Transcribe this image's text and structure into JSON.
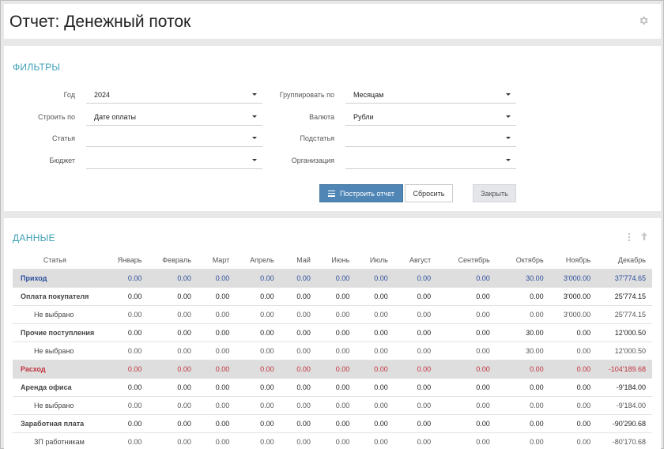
{
  "page": {
    "title": "Отчет: Денежный поток"
  },
  "colors": {
    "accent": "#3d9fb6",
    "primary_button": "#4f86b6",
    "income": "#2c4f9e",
    "expense": "#c0313d"
  },
  "icons": {
    "settings": "gear-icon",
    "build": "list-icon",
    "menu": "vertical-dots-icon",
    "collapse": "arrow-up-icon"
  },
  "filters": {
    "title": "ФИЛЬТРЫ",
    "year": {
      "label": "Год",
      "value": "2024"
    },
    "build_by": {
      "label": "Строить по",
      "value": "Дате оплаты"
    },
    "article": {
      "label": "Статья",
      "value": ""
    },
    "budget": {
      "label": "Бюджет",
      "value": ""
    },
    "group_by": {
      "label": "Группировать по",
      "value": "Месяцам"
    },
    "currency": {
      "label": "Валюта",
      "value": "Рубли"
    },
    "subarticle": {
      "label": "Подстатья",
      "value": ""
    },
    "organization": {
      "label": "Организация",
      "value": ""
    },
    "buttons": {
      "build": "Построить отчет",
      "reset": "Сбросить",
      "close": "Закрыть"
    }
  },
  "data_section": {
    "title": "ДАННЫЕ",
    "columns": [
      "Статья",
      "Январь",
      "Февраль",
      "Март",
      "Апрель",
      "Май",
      "Июнь",
      "Июль",
      "Август",
      "Сентябрь",
      "Октябрь",
      "Ноябрь",
      "Декабрь"
    ],
    "rows": [
      {
        "kind": "top-in",
        "cells": [
          "Приход",
          "0.00",
          "0.00",
          "0.00",
          "0.00",
          "0.00",
          "0.00",
          "0.00",
          "0.00",
          "0.00",
          "30.00",
          "3'000.00",
          "37'774.65"
        ]
      },
      {
        "kind": "lvl1",
        "cells": [
          "Оплата покупателя",
          "0.00",
          "0.00",
          "0.00",
          "0.00",
          "0.00",
          "0.00",
          "0.00",
          "0.00",
          "0.00",
          "0.00",
          "3'000.00",
          "25'774.15"
        ]
      },
      {
        "kind": "lvl2",
        "cells": [
          "Не выбрано",
          "0.00",
          "0.00",
          "0.00",
          "0.00",
          "0.00",
          "0.00",
          "0.00",
          "0.00",
          "0.00",
          "0.00",
          "3'000.00",
          "25'774.15"
        ]
      },
      {
        "kind": "lvl1",
        "cells": [
          "Прочие поступления",
          "0.00",
          "0.00",
          "0.00",
          "0.00",
          "0.00",
          "0.00",
          "0.00",
          "0.00",
          "0.00",
          "30.00",
          "0.00",
          "12'000.50"
        ]
      },
      {
        "kind": "lvl2",
        "cells": [
          "Не выбрано",
          "0.00",
          "0.00",
          "0.00",
          "0.00",
          "0.00",
          "0.00",
          "0.00",
          "0.00",
          "0.00",
          "30.00",
          "0.00",
          "12'000.50"
        ]
      },
      {
        "kind": "top-out",
        "cells": [
          "Расход",
          "0.00",
          "0.00",
          "0.00",
          "0.00",
          "0.00",
          "0.00",
          "0.00",
          "0.00",
          "0.00",
          "0.00",
          "0.00",
          "-104'189.68"
        ]
      },
      {
        "kind": "lvl1",
        "cells": [
          "Аренда офиса",
          "0.00",
          "0.00",
          "0.00",
          "0.00",
          "0.00",
          "0.00",
          "0.00",
          "0.00",
          "0.00",
          "0.00",
          "0.00",
          "-9'184.00"
        ]
      },
      {
        "kind": "lvl2",
        "cells": [
          "Не выбрано",
          "0.00",
          "0.00",
          "0.00",
          "0.00",
          "0.00",
          "0.00",
          "0.00",
          "0.00",
          "0.00",
          "0.00",
          "0.00",
          "-9'184.00"
        ]
      },
      {
        "kind": "lvl1",
        "cells": [
          "Заработная плата",
          "0.00",
          "0.00",
          "0.00",
          "0.00",
          "0.00",
          "0.00",
          "0.00",
          "0.00",
          "0.00",
          "0.00",
          "0.00",
          "-90'290.68"
        ]
      },
      {
        "kind": "lvl2",
        "cells": [
          "ЗП работникам",
          "0.00",
          "0.00",
          "0.00",
          "0.00",
          "0.00",
          "0.00",
          "0.00",
          "0.00",
          "0.00",
          "0.00",
          "0.00",
          "-80'170.68"
        ]
      }
    ]
  }
}
